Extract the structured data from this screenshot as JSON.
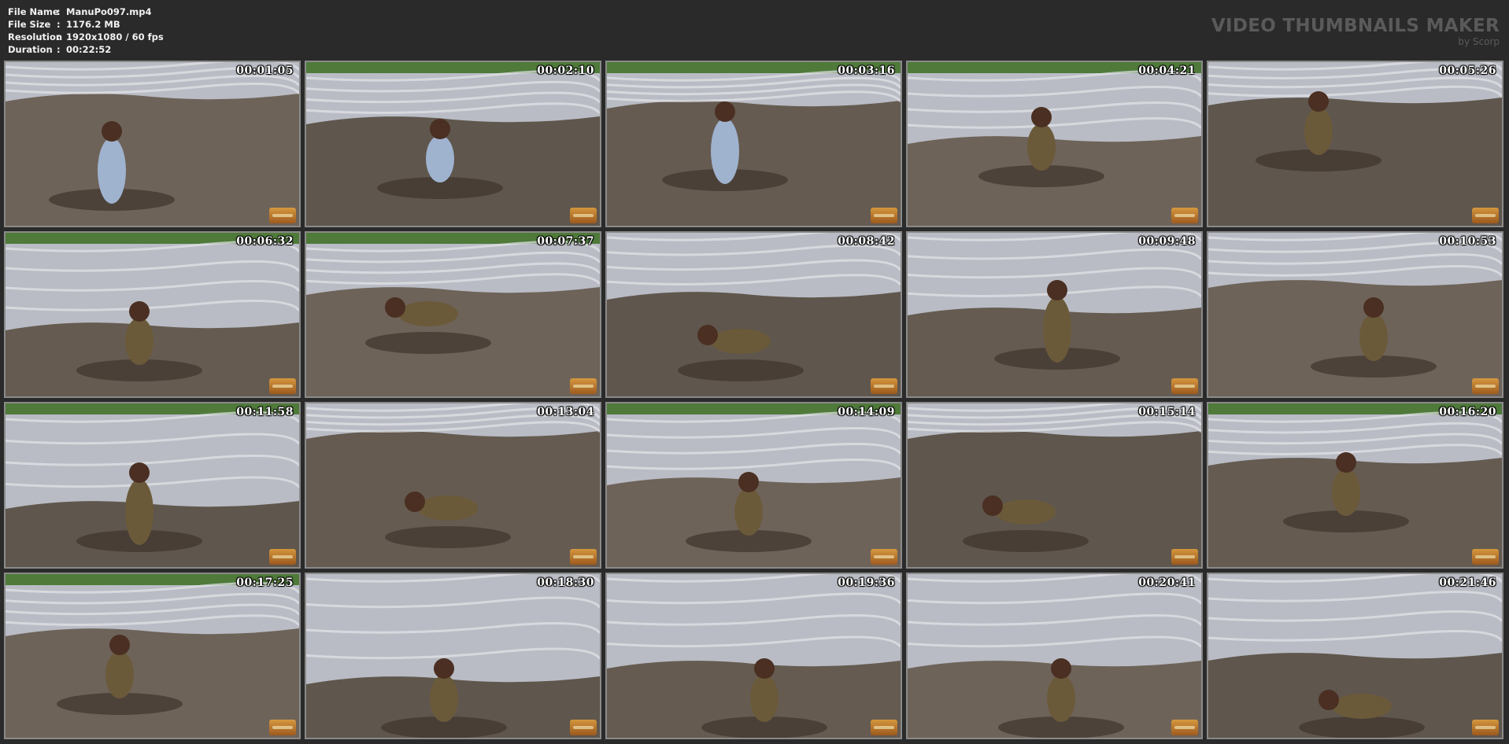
{
  "file_info": {
    "separator": ":",
    "rows": [
      {
        "label": "File Name",
        "value": "ManuPo097.mp4"
      },
      {
        "label": "File Size",
        "value": "1176.2 MB"
      },
      {
        "label": "Resolution",
        "value": "1920x1080 / 60 fps"
      },
      {
        "label": "Duration",
        "value": "00:22:52"
      }
    ]
  },
  "brand": {
    "title": "VIDEO THUMBNAILS MAKER",
    "subtitle": "by Scorp"
  },
  "thumbnails": [
    {
      "timestamp": "00:01:05"
    },
    {
      "timestamp": "00:02:10"
    },
    {
      "timestamp": "00:03:16"
    },
    {
      "timestamp": "00:04:21"
    },
    {
      "timestamp": "00:05:26"
    },
    {
      "timestamp": "00:06:32"
    },
    {
      "timestamp": "00:07:37"
    },
    {
      "timestamp": "00:08:42"
    },
    {
      "timestamp": "00:09:48"
    },
    {
      "timestamp": "00:10:53"
    },
    {
      "timestamp": "00:11:58"
    },
    {
      "timestamp": "00:13:04"
    },
    {
      "timestamp": "00:14:09"
    },
    {
      "timestamp": "00:15:14"
    },
    {
      "timestamp": "00:16:20"
    },
    {
      "timestamp": "00:17:25"
    },
    {
      "timestamp": "00:18:30"
    },
    {
      "timestamp": "00:19:36"
    },
    {
      "timestamp": "00:20:41"
    },
    {
      "timestamp": "00:21:46"
    }
  ],
  "colors": {
    "background": "#2a2a2a",
    "thumb_border": "#8a8a8a",
    "brand_text": "#5a5a5a"
  }
}
